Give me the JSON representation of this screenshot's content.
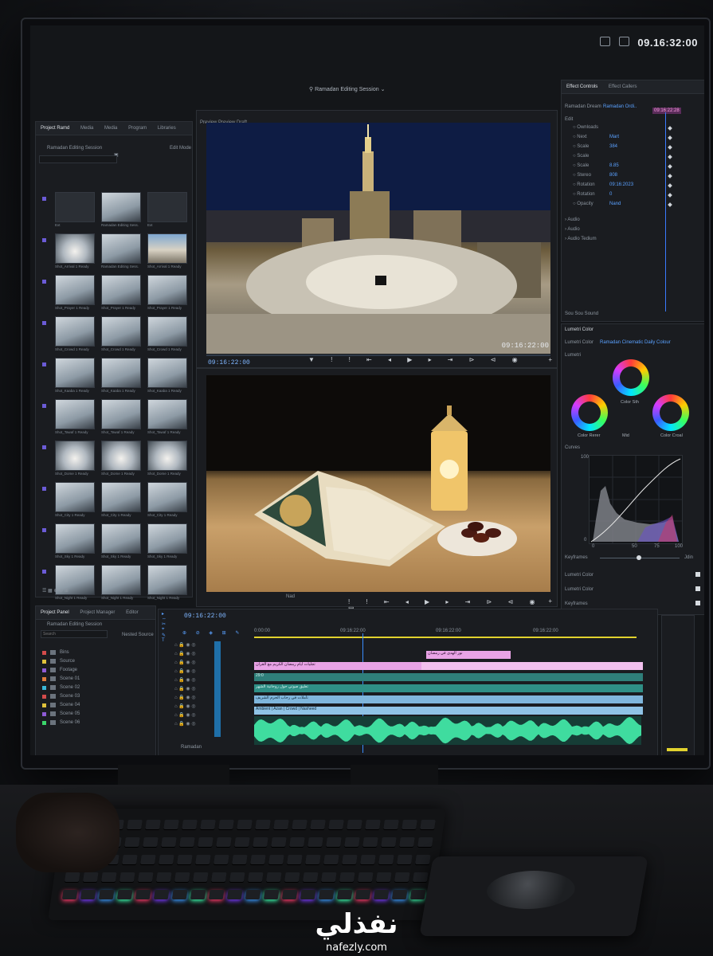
{
  "top": {
    "clock": "09.16:32:00",
    "session_title": "Ramadan Editing Session"
  },
  "project_panel": {
    "tabs": [
      "Project Ramd",
      "Media",
      "Media",
      "Program",
      "Libraries"
    ],
    "title": "Ramadan Editing Session",
    "list_view_label": "Edit Mode",
    "items": [
      "Ext",
      "Ramadan Editing Sess.",
      "Ext",
      "Shot_Arrival 1 Ready",
      "Ramadan Editing Sess.",
      "Shot_Arrival 1 Ready",
      "Shot_Prayer 1 Ready",
      "Shot_Prayer 1 Ready",
      "Shot_Prayer 1 Ready",
      "Shot_Crowd 1 Ready",
      "Shot_Crowd 1 Ready",
      "Shot_Crowd 1 Ready",
      "Shot_Kaaba 1 Ready",
      "Shot_Kaaba 1 Ready",
      "Shot_Kaaba 1 Ready",
      "Shot_Tawaf 1 Ready",
      "Shot_Tawaf 1 Ready",
      "Shot_Tawaf 1 Ready",
      "Shot_Dome 1 Ready",
      "Shot_Dome 1 Ready",
      "Shot_Dome 1 Ready",
      "Shot_City 1 Ready",
      "Shot_City 1 Ready",
      "Shot_City 1 Ready",
      "Shot_Sky 1 Ready",
      "Shot_Sky 1 Ready",
      "Shot_Sky 1 Ready",
      "Shot_Night 1 Ready",
      "Shot_Night 1 Ready",
      "Shot_Night 1 Ready"
    ]
  },
  "project_panel_2": {
    "tabs": [
      "Project Panel",
      "Project Manager",
      "Editor"
    ],
    "title": "Ramadan Editing Session",
    "search_placeholder": "Search",
    "label_right": "Nested Source",
    "bins": [
      "Bins",
      "Source",
      "Footage",
      "Scene 01",
      "Scene 02",
      "Scene 03",
      "Scene 04",
      "Scene 05",
      "Scene 06"
    ]
  },
  "source_monitor": {
    "title": "Preview Preview Draft",
    "timecode_left": "09:16:22:00",
    "timecode_right": "09:16:22:00"
  },
  "program_monitor": {
    "label": "Nad"
  },
  "effect_controls": {
    "tab": "Effect Controls",
    "tab2": "Effect Callers",
    "source_label": "Ramadan Dream",
    "source_value": "Ramadan Ordi..",
    "timecode": "09:16:22:28",
    "section": "Edit",
    "properties": [
      {
        "name": "Ownloads",
        "value": ""
      },
      {
        "name": "Next",
        "value": "Mart"
      },
      {
        "name": "Scale",
        "value": "384"
      },
      {
        "name": "Scale",
        "value": ""
      },
      {
        "name": "Scale",
        "value": "8.85"
      },
      {
        "name": "Stereo",
        "value": "808"
      },
      {
        "name": "Rotation",
        "value": "09:16:2023"
      },
      {
        "name": "Rotation",
        "value": "0"
      },
      {
        "name": "Opacity",
        "value": "Nand"
      }
    ],
    "groups": [
      "Audio",
      "Audio",
      "Audio Tedium"
    ],
    "footer": "Sou Sou Sound"
  },
  "lumetri": {
    "title": "Lumetri Color",
    "sub_label": "Lumetri Color",
    "sub_value": "Ramadan Cinematic Daily Colour",
    "wheels_label": "Lumetri",
    "wheel_labels": [
      "Color Sth",
      "Color Rerer",
      "Color Croal"
    ],
    "mid_label": "Mid",
    "curves_label": "Curves",
    "axis_y_top": "100",
    "axis_y_bottom": "0",
    "axis_x": [
      "0",
      "50",
      "75",
      "100"
    ],
    "keyframes_label": "Keyframes",
    "keyframes_value": "Jdin",
    "rows": [
      "Lumetri Color",
      "Lumetri Color",
      "Keyframes"
    ]
  },
  "timeline": {
    "tab": "09:16:22:00",
    "ruler": [
      "0:00:00",
      "09:16:22:00",
      "09:16:22:00",
      "09:16:22:00"
    ],
    "clips": [
      "نور الهدى في رمضان",
      "تجليات أيام رمضان الكريم مع القرآن",
      "29:0",
      "تعليق صوتي حول روحانية الشهر",
      "تأملات في رحاب الحرم الشريف",
      "Ambient | Azan | Crowd | Nasheed"
    ],
    "footer": "Ramadan"
  },
  "brand": {
    "arabic": "نفذلي",
    "latin": "nafezly.com"
  }
}
